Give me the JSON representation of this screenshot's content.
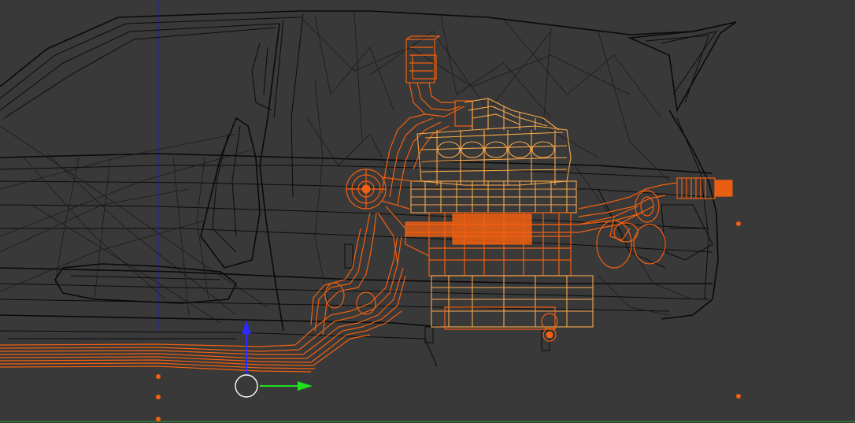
{
  "viewport": {
    "background_color": "#393939",
    "grid_color": "#3f3f3f",
    "wireframe_color": "#0c0c0c",
    "selected_color": "#f26010",
    "active_color": "#f8a84a",
    "axis_z_color": "#1a1aff",
    "axis_y_color": "#3a9a3a"
  },
  "manipulator": {
    "x_arrow_color": "#1ee01e",
    "z_arrow_color": "#2b2bff",
    "center_ring_color": "#ffffff"
  },
  "objects": [
    {
      "name": "car-body",
      "selected": false
    },
    {
      "name": "engine-block",
      "selected": true
    },
    {
      "name": "exhaust-pipe",
      "selected": true
    },
    {
      "name": "intake-pipe",
      "selected": true
    }
  ]
}
